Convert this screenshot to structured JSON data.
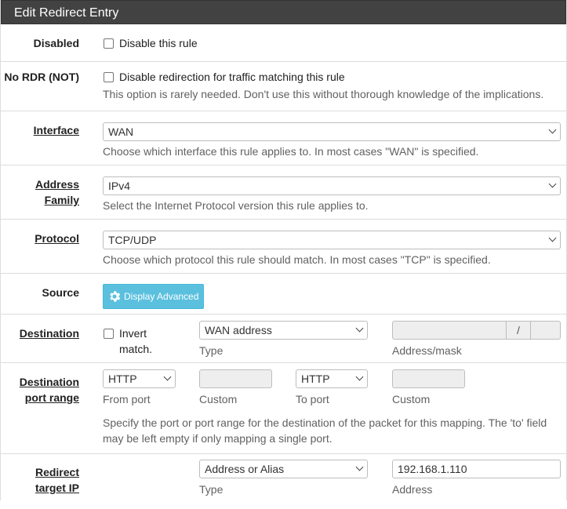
{
  "panel": {
    "title": "Edit Redirect Entry"
  },
  "disabled": {
    "label": "Disabled",
    "checkbox_label": "Disable this rule"
  },
  "no_rdr": {
    "label": "No RDR (NOT)",
    "checkbox_label": "Disable redirection for traffic matching this rule",
    "help": "This option is rarely needed. Don't use this without thorough knowledge of the implications."
  },
  "interface": {
    "label": "Interface",
    "value": "WAN",
    "help": "Choose which interface this rule applies to. In most cases \"WAN\" is specified."
  },
  "address_family": {
    "label_line1": "Address",
    "label_line2": "Family",
    "value": "IPv4",
    "help": "Select the Internet Protocol version this rule applies to."
  },
  "protocol": {
    "label": "Protocol",
    "value": "TCP/UDP",
    "help": "Choose which protocol this rule should match. In most cases \"TCP\" is specified."
  },
  "source": {
    "label": "Source",
    "button_label": "Display Advanced"
  },
  "destination": {
    "label": "Destination",
    "invert_line1": "Invert",
    "invert_line2": "match.",
    "type_value": "WAN address",
    "type_caption": "Type",
    "address_value": "",
    "separator": "/",
    "address_caption": "Address/mask"
  },
  "dest_port_range": {
    "label_line1": "Destination",
    "label_line2": "port range",
    "from_value": "HTTP",
    "from_caption": "From port",
    "custom1_caption": "Custom",
    "to_value": "HTTP",
    "to_caption": "To port",
    "custom2_caption": "Custom",
    "help_line1": "Specify the port or port range for the destination of the packet for this mapping. The 'to' field",
    "help_line2": "may be left empty if only mapping a single port."
  },
  "redirect_target": {
    "label_line1": "Redirect",
    "label_line2": "target IP",
    "type_value": "Address or Alias",
    "type_caption": "Type",
    "address_value": "192.168.1.110",
    "address_caption": "Address"
  },
  "colors": {
    "heading_bg": "#424242",
    "button_info": "#5bc0de"
  },
  "icons": {
    "gear": "gear-icon",
    "chevron": "chevron-down-icon"
  }
}
